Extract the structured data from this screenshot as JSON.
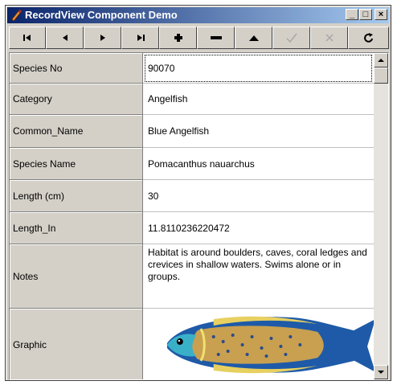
{
  "window": {
    "title": "RecordView Component Demo",
    "controls": {
      "minimize": "_",
      "maximize": "□",
      "close": "×"
    }
  },
  "navigator": {
    "buttons": [
      {
        "name": "first-record-button",
        "icon": "first-icon",
        "enabled": true
      },
      {
        "name": "prior-record-button",
        "icon": "prior-icon",
        "enabled": true
      },
      {
        "name": "next-record-button",
        "icon": "next-icon",
        "enabled": true
      },
      {
        "name": "last-record-button",
        "icon": "last-icon",
        "enabled": true
      },
      {
        "name": "insert-record-button",
        "icon": "plus-icon",
        "enabled": true
      },
      {
        "name": "delete-record-button",
        "icon": "minus-icon",
        "enabled": true
      },
      {
        "name": "edit-record-button",
        "icon": "up-triangle-icon",
        "enabled": true
      },
      {
        "name": "post-record-button",
        "icon": "check-icon",
        "enabled": false
      },
      {
        "name": "cancel-record-button",
        "icon": "x-icon",
        "enabled": false
      },
      {
        "name": "refresh-record-button",
        "icon": "refresh-icon",
        "enabled": true
      }
    ]
  },
  "record": {
    "fields": [
      {
        "label": "Species No",
        "value": "90070"
      },
      {
        "label": "Category",
        "value": "Angelfish"
      },
      {
        "label": "Common_Name",
        "value": "Blue Angelfish"
      },
      {
        "label": "Species Name",
        "value": "Pomacanthus nauarchus"
      },
      {
        "label": "Length (cm)",
        "value": "30"
      },
      {
        "label": "Length_In",
        "value": "11.8110236220472"
      },
      {
        "label": "Notes",
        "value": "Habitat is around boulders, caves, coral ledges and crevices in shallow waters.  Swims alone or in groups."
      },
      {
        "label": "Graphic",
        "value": ""
      }
    ]
  },
  "colors": {
    "titlebar_start": "#0a246a",
    "titlebar_end": "#a6caf0",
    "face": "#d4d0c8"
  }
}
